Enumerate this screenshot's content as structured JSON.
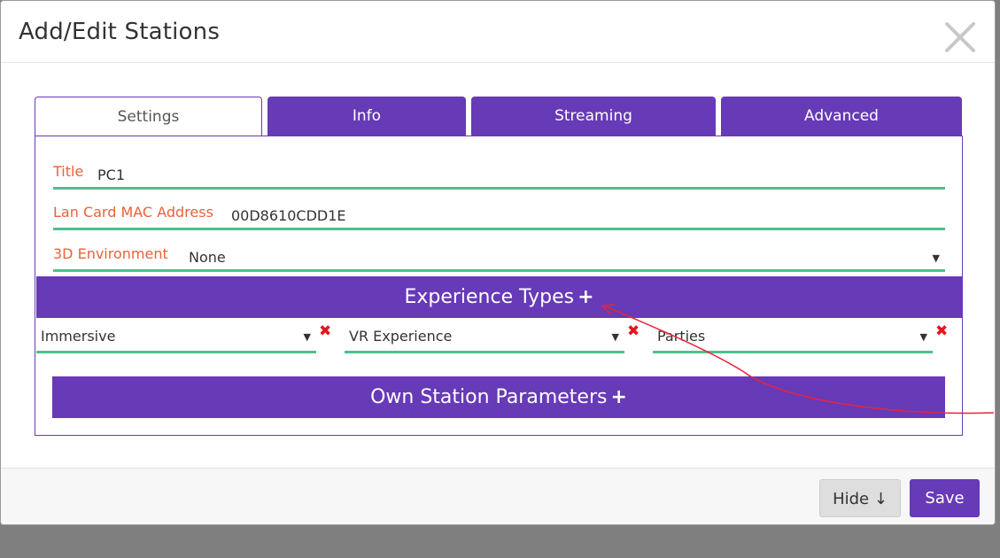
{
  "modal": {
    "title": "Add/Edit Stations"
  },
  "tabs": [
    {
      "label": "Settings",
      "active": true
    },
    {
      "label": "Info",
      "active": false
    },
    {
      "label": "Streaming",
      "active": false
    },
    {
      "label": "Advanced",
      "active": false
    }
  ],
  "fields": {
    "title": {
      "label": "Title",
      "value": "PC1"
    },
    "mac": {
      "label": "Lan Card MAC Address",
      "value": "00D8610CDD1E"
    },
    "env": {
      "label": "3D Environment",
      "value": "None"
    }
  },
  "experience": {
    "header": "Experience Types",
    "plus": "+",
    "selects": [
      {
        "value": "Immersive"
      },
      {
        "value": "VR Experience"
      },
      {
        "value": "Parties"
      }
    ],
    "remove": "✖"
  },
  "own_params": {
    "header": "Own Station Parameters",
    "plus": "+"
  },
  "footer": {
    "hide_label": "Hide ↓",
    "save_label": "Save"
  },
  "icons": {
    "close": "close-icon",
    "dropdown": "chevron-down-icon",
    "remove": "remove-icon",
    "add": "plus-icon"
  },
  "colors": {
    "accent": "#673ab7",
    "underline": "#4fbf8c",
    "label": "#e8623a",
    "remove": "#e4161c",
    "annotation": "#e8243c"
  }
}
